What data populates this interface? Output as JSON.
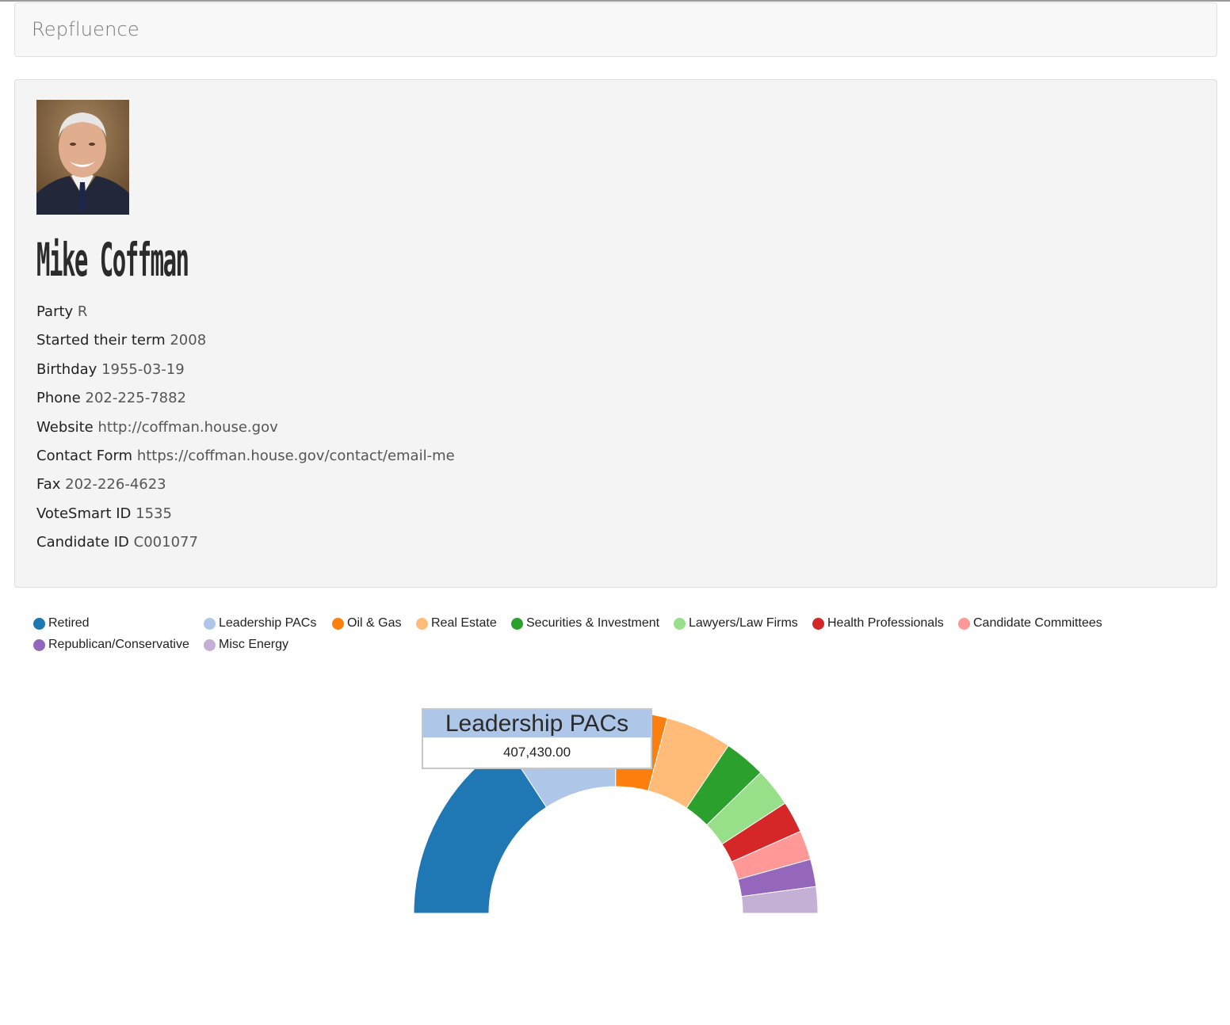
{
  "app": {
    "brand": "Repfluence"
  },
  "profile": {
    "name": "Mike Coffman",
    "photo_alt": "portrait",
    "fields": [
      {
        "label": "Party",
        "value": "R"
      },
      {
        "label": "Started their term",
        "value": "2008"
      },
      {
        "label": "Birthday",
        "value": "1955-03-19"
      },
      {
        "label": "Phone",
        "value": "202-225-7882"
      },
      {
        "label": "Website",
        "value": "http://coffman.house.gov"
      },
      {
        "label": "Contact Form",
        "value": "https://coffman.house.gov/contact/email-me"
      },
      {
        "label": "Fax",
        "value": "202-226-4623"
      },
      {
        "label": "VoteSmart ID",
        "value": "1535"
      },
      {
        "label": "Candidate ID",
        "value": "C001077"
      }
    ]
  },
  "legend": [
    {
      "label": "Retired",
      "color": "#1f77b4"
    },
    {
      "label": "Leadership PACs",
      "color": "#aec7e8"
    },
    {
      "label": "Oil & Gas",
      "color": "#ff7f0e"
    },
    {
      "label": "Real Estate",
      "color": "#ffbb78"
    },
    {
      "label": "Securities & Investment",
      "color": "#2ca02c"
    },
    {
      "label": "Lawyers/Law Firms",
      "color": "#98df8a"
    },
    {
      "label": "Health Professionals",
      "color": "#d62728"
    },
    {
      "label": "Candidate Committees",
      "color": "#ff9896"
    },
    {
      "label": "Republican/Conservative",
      "color": "#9467bd"
    },
    {
      "label": "Misc Energy",
      "color": "#c5b0d5"
    }
  ],
  "tooltip": {
    "title": "Leadership PACs",
    "value": "407,430.00",
    "color": "#aec7e8"
  },
  "chart_data": {
    "type": "pie",
    "shape": "half-donut",
    "categories": [
      "Retired",
      "Leadership PACs",
      "Oil & Gas",
      "Real Estate",
      "Securities & Investment",
      "Lawyers/Law Firms",
      "Health Professionals",
      "Candidate Committees",
      "Republican/Conservative",
      "Misc Energy"
    ],
    "values": [
      700000,
      407430,
      183000,
      235000,
      147000,
      137000,
      112000,
      104000,
      97000,
      94000
    ],
    "colors": [
      "#1f77b4",
      "#aec7e8",
      "#ff7f0e",
      "#ffbb78",
      "#2ca02c",
      "#98df8a",
      "#d62728",
      "#ff9896",
      "#9467bd",
      "#c5b0d5"
    ]
  }
}
